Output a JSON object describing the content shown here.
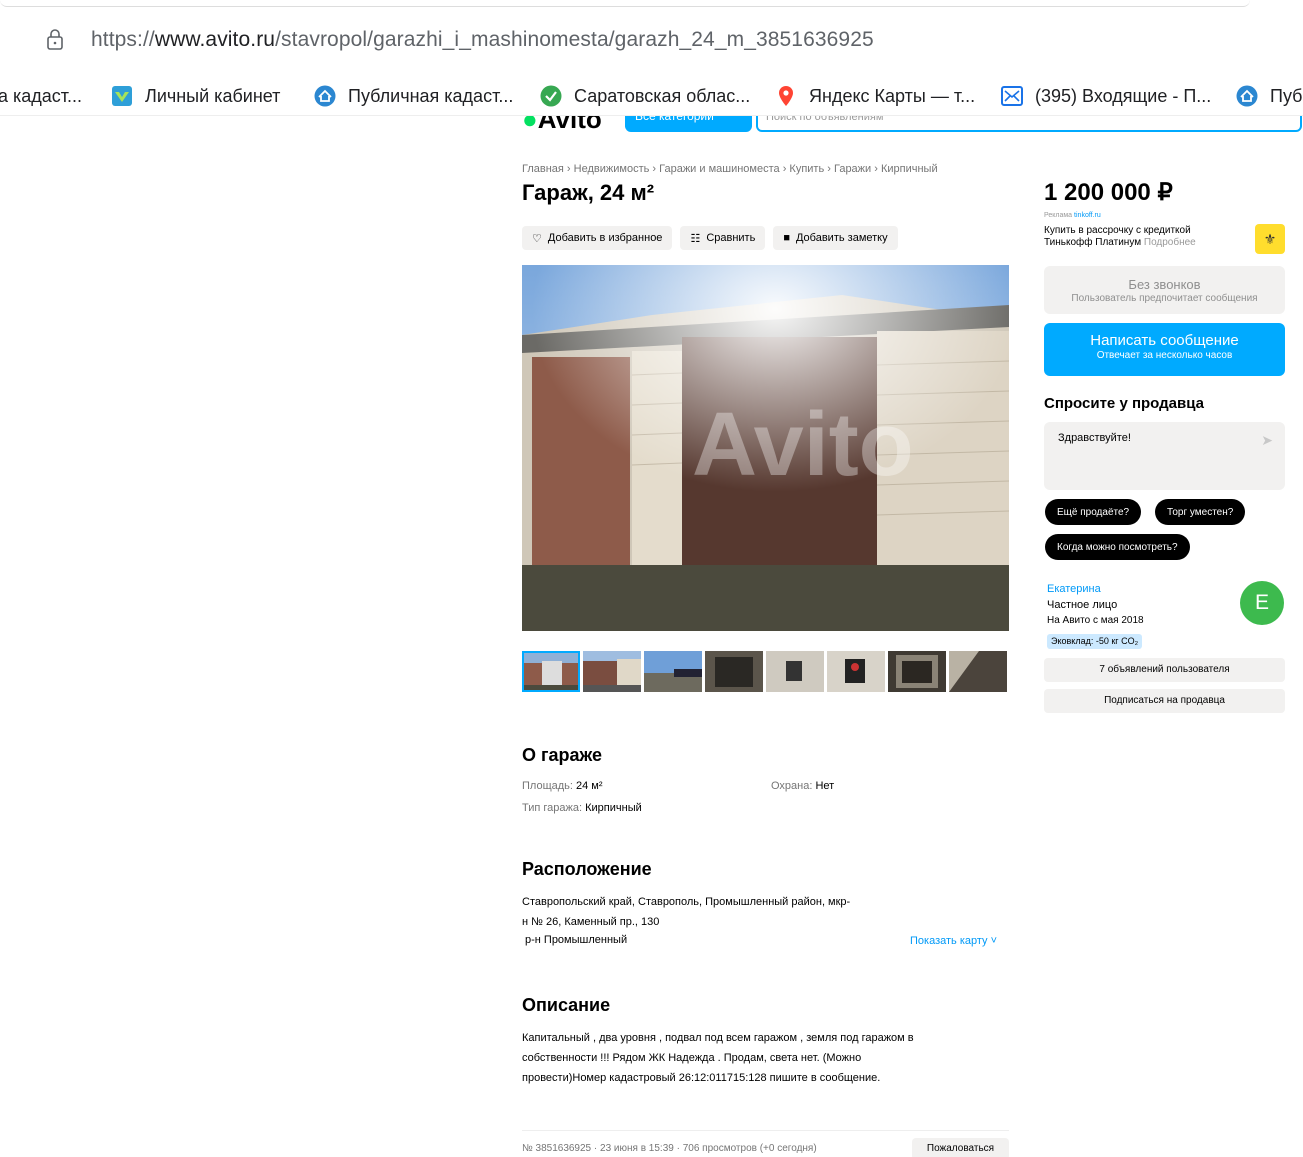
{
  "browser": {
    "url_prefix": "https://",
    "url_host": "www.avito.ru",
    "url_path": "/stavropol/garazhi_i_mashinomesta/garazh_24_m_3851636925",
    "bookmarks": [
      {
        "label": "а кадаст...",
        "icon": "none"
      },
      {
        "label": "Личный кабинет",
        "icon": "rosreestr-icon"
      },
      {
        "label": "Публичная кадаст...",
        "icon": "house-icon"
      },
      {
        "label": "Саратовская облас...",
        "icon": "check-icon"
      },
      {
        "label": "Яндекс Карты — т...",
        "icon": "map-pin-icon"
      },
      {
        "label": "(395) Входящие - П...",
        "icon": "mail-icon"
      },
      {
        "label": "Пуб",
        "icon": "house-icon"
      }
    ]
  },
  "header": {
    "logo_text": "Avito",
    "categories_label": "Все категории",
    "search_placeholder": "Поиск по объявлениям"
  },
  "breadcrumbs": [
    "Главная",
    "Недвижимость",
    "Гаражи и машиноместа",
    "Купить",
    "Гаражи",
    "Кирпичный"
  ],
  "listing": {
    "title": "Гараж, 24 м²",
    "actions": {
      "favorite": "Добавить в избранное",
      "compare": "Сравнить",
      "note": "Добавить заметку"
    },
    "watermark": "Avito",
    "thumb_count": 8
  },
  "about": {
    "title": "О гараже",
    "area_label": "Площадь:",
    "area_value": "24 м²",
    "type_label": "Тип гаража:",
    "type_value": "Кирпичный",
    "guard_label": "Охрана:",
    "guard_value": "Нет"
  },
  "location": {
    "title": "Расположение",
    "address_line1": "Ставропольский край, Ставрополь, Промышленный район, мкр-",
    "address_line2": "н № 26, Каменный пр., 130",
    "district": "р-н Промышленный",
    "show_map": "Показать карту ˅"
  },
  "description": {
    "title": "Описание",
    "line1": "Капитальный , два уровня , подвал под всем гаражом , земля под гаражом в",
    "line2": "собственности !!! Рядом ЖК Надежда . Продам, света нет. (Можно",
    "line3": "провести)Номер кадастровый 26:12:011715:128 пишите в сообщение."
  },
  "footer": {
    "meta": "№ 3851636925 · 23 июня в 15:39 · 706 просмотров (+0 сегодня)",
    "report": "Пожаловаться"
  },
  "sidebar": {
    "price": "1 200 000 ₽",
    "ad_label": "Реклама",
    "ad_link": "tinkoff.ru",
    "ad_line1": "Купить в рассрочку с кредиткой",
    "ad_line2": "Тинькофф Платинум",
    "ad_more": "Подробнее",
    "nocalls_title": "Без звонков",
    "nocalls_sub": "Пользователь предпочитает сообщения",
    "write_btn": "Написать сообщение",
    "write_sub": "Отвечает за несколько часов",
    "ask_title": "Спросите у продавца",
    "ask_text": "Здравствуйте!",
    "chips": [
      "Ещё продаёте?",
      "Торг уместен?",
      "Когда можно посмотреть?"
    ],
    "seller_name": "Екатерина",
    "seller_type": "Частное лицо",
    "seller_since": "На Авито с мая 2018",
    "eco": "Эковклад: -50 кг CO₂",
    "avatar_letter": "Е",
    "ads_btn": "7 объявлений пользователя",
    "subscribe_btn": "Подписаться на продавца"
  }
}
